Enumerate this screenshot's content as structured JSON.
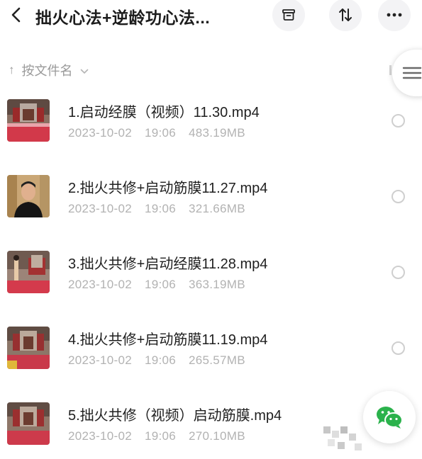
{
  "header": {
    "title": "拙火心法+逆龄功心法..."
  },
  "icons": {
    "back": "chevron-left-icon",
    "archive": "archive-box-icon",
    "sort": "sort-arrows-icon",
    "more": "more-dots-icon",
    "sort_direction": "arrow-up-icon",
    "side_menu": "hamburger-icon",
    "share": "wechat-icon"
  },
  "sort": {
    "label": "按文件名",
    "arrow": "↑"
  },
  "colors": {
    "wechat_green": "#2bb24c",
    "meta_gray": "#b2b2b2"
  },
  "files": [
    {
      "name": "1.启动经膜（视频）11.30.mp4",
      "date": "2023-10-02",
      "time": "19:06",
      "size": "483.19MB"
    },
    {
      "name": "2.拙火共修+启动筋膜11.27.mp4",
      "date": "2023-10-02",
      "time": "19:06",
      "size": "321.66MB"
    },
    {
      "name": "3.拙火共修+启动经膜11.28.mp4",
      "date": "2023-10-02",
      "time": "19:06",
      "size": "363.19MB"
    },
    {
      "name": "4.拙火共修+启动筋膜11.19.mp4",
      "date": "2023-10-02",
      "time": "19:06",
      "size": "265.57MB"
    },
    {
      "name": "5.拙火共修（视频）启动筋膜.mp4",
      "date": "2023-10-02",
      "time": "19:06",
      "size": "270.10MB"
    }
  ]
}
